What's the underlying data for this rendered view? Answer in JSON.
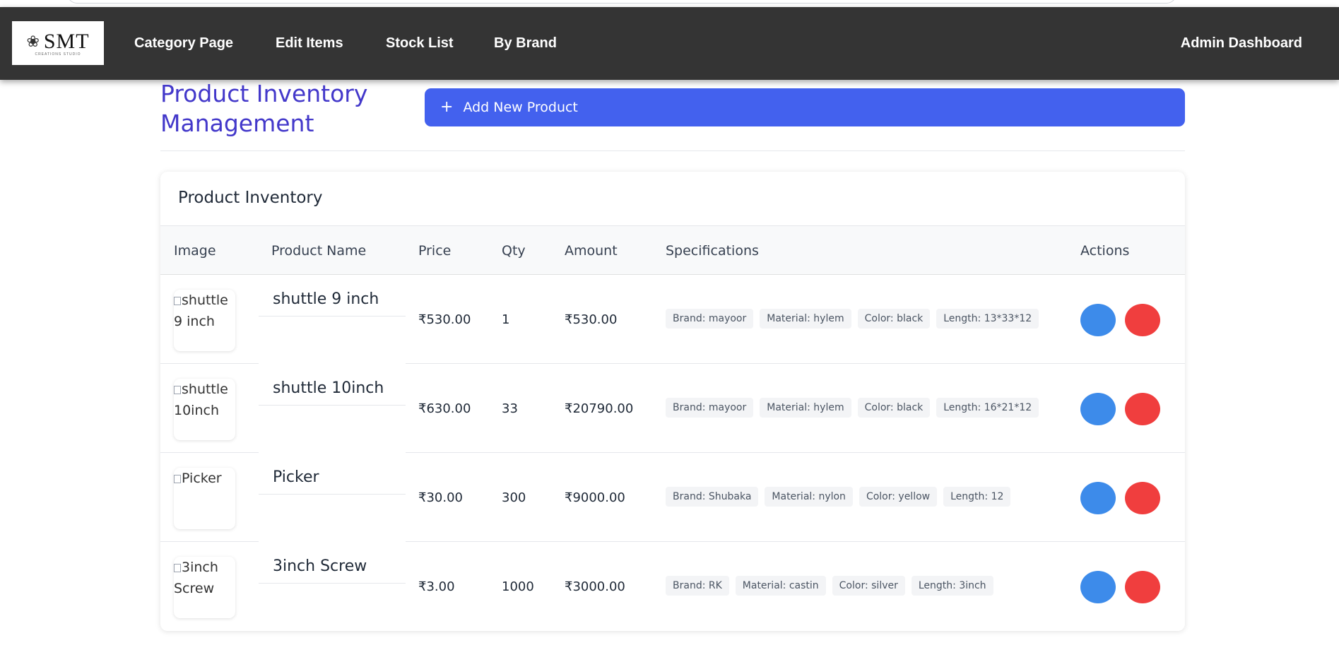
{
  "navbar": {
    "logo_text": "SMT",
    "logo_sub": "CREATIONS STUDIO",
    "links": [
      "Category Page",
      "Edit Items",
      "Stock List",
      "By Brand"
    ],
    "right_link": "Admin Dashboard"
  },
  "page": {
    "title": "Product Inventory Management",
    "add_button_label": "Add New Product",
    "add_button_icon": "plus-icon"
  },
  "inventory": {
    "title": "Product Inventory",
    "columns": [
      "Image",
      "Product Name",
      "Price",
      "Qty",
      "Amount",
      "Specifications",
      "Actions"
    ],
    "rows": [
      {
        "image_alt": "shuttle 9 inch",
        "name": "shuttle 9 inch",
        "price": "₹530.00",
        "qty": "1",
        "amount": "₹530.00",
        "specs": [
          "Brand: mayoor",
          "Material: hylem",
          "Color: black",
          "Length: 13*33*12"
        ]
      },
      {
        "image_alt": "shuttle 10inch",
        "name": "shuttle 10inch",
        "price": "₹630.00",
        "qty": "33",
        "amount": "₹20790.00",
        "specs": [
          "Brand: mayoor",
          "Material: hylem",
          "Color: black",
          "Length: 16*21*12"
        ]
      },
      {
        "image_alt": "Picker",
        "name": "Picker",
        "price": "₹30.00",
        "qty": "300",
        "amount": "₹9000.00",
        "specs": [
          "Brand: Shubaka",
          "Material: nylon",
          "Color: yellow",
          "Length: 12"
        ]
      },
      {
        "image_alt": "3inch Screw",
        "name": "3inch Screw",
        "price": "₹3.00",
        "qty": "1000",
        "amount": "₹3000.00",
        "specs": [
          "Brand: RK",
          "Material: castin",
          "Color: silver",
          "Length: 3inch"
        ]
      }
    ]
  },
  "colors": {
    "navbar_bg": "#343434",
    "title_color": "#4338ca",
    "add_button_bg": "#4361ee",
    "edit_button": "#3d8bea",
    "delete_button": "#f03e3e"
  }
}
